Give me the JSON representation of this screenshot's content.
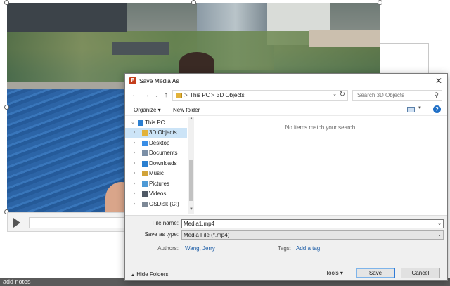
{
  "background": {
    "status_text": "add notes"
  },
  "dialog": {
    "title": "Save Media As",
    "close_label": "✕",
    "nav": {
      "back": "←",
      "forward": "→",
      "recent": "⌄",
      "up": "↑",
      "breadcrumb": [
        "This PC",
        "3D Objects"
      ],
      "separator": ">",
      "search_placeholder": "Search 3D Objects"
    },
    "toolbar": {
      "organize_label": "Organize ▾",
      "new_folder_label": "New folder"
    },
    "tree": [
      {
        "label": "This PC",
        "icon": "computer-icon",
        "color": "#2b7fd1"
      },
      {
        "label": "3D Objects",
        "icon": "3d-objects-icon",
        "color": "#e2b23a"
      },
      {
        "label": "Desktop",
        "icon": "desktop-icon",
        "color": "#3a8ee6"
      },
      {
        "label": "Documents",
        "icon": "documents-icon",
        "color": "#7c8fa6"
      },
      {
        "label": "Downloads",
        "icon": "downloads-icon",
        "color": "#2a7fd0"
      },
      {
        "label": "Music",
        "icon": "music-icon",
        "color": "#d1a33a"
      },
      {
        "label": "Pictures",
        "icon": "pictures-icon",
        "color": "#4e9ad6"
      },
      {
        "label": "Videos",
        "icon": "videos-icon",
        "color": "#505a66"
      },
      {
        "label": "OSDisk (C:)",
        "icon": "drive-icon",
        "color": "#7d8896"
      }
    ],
    "empty_message": "No items match your search.",
    "form": {
      "file_name_label": "File name:",
      "file_name_value": "Media1.mp4",
      "save_type_label": "Save as type:",
      "save_type_value": "Media File (*.mp4)",
      "authors_label": "Authors:",
      "authors_value": "Wang, Jerry",
      "tags_label": "Tags:",
      "tags_value": "Add a tag"
    },
    "footer": {
      "hide_folders_label": "Hide Folders",
      "tools_label": "Tools  ▾",
      "save_label": "Save",
      "cancel_label": "Cancel"
    }
  }
}
